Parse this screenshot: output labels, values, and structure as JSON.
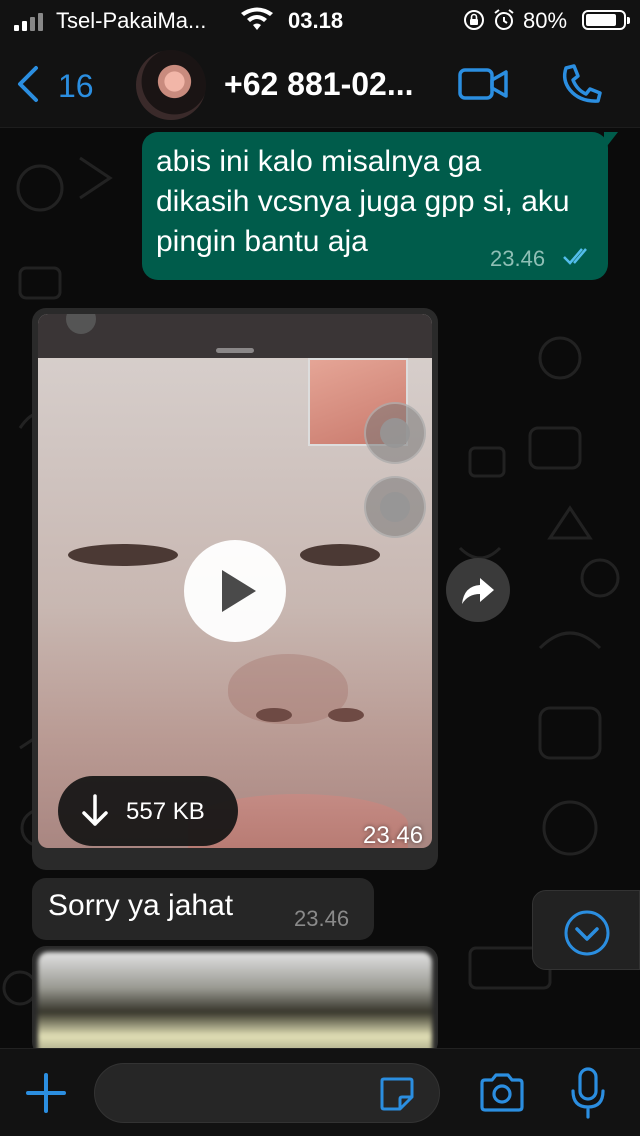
{
  "status_bar": {
    "carrier": "Tsel-PakaiMa...",
    "time": "03.18",
    "battery": "80%",
    "icons": [
      "signal-icon",
      "wifi-icon",
      "rotation-lock-icon",
      "alarm-icon",
      "battery-icon"
    ]
  },
  "header": {
    "back_count": "16",
    "contact_name": "+62 881-02...",
    "icons": [
      "chevron-left-icon",
      "video-call-icon",
      "phone-icon"
    ],
    "accent_color": "#2b8ee0"
  },
  "messages": [
    {
      "type": "outgoing_text",
      "text": "abis ini kalo misalnya ga dikasih vcsnya juga gpp si, aku pingin bantu aja",
      "time": "23.46",
      "status_icon": "double-check-icon",
      "bubble_color": "#005c4b"
    },
    {
      "type": "incoming_video",
      "size": "557 KB",
      "time": "23.46",
      "icons": [
        "play-icon",
        "download-icon",
        "forward-icon"
      ]
    },
    {
      "type": "incoming_text",
      "text": "Sorry ya jahat",
      "time": "23.46",
      "bubble_color": "#262626"
    },
    {
      "type": "incoming_image"
    }
  ],
  "input_bar": {
    "placeholder": "",
    "icons": [
      "plus-icon",
      "sticker-icon",
      "camera-icon",
      "microphone-icon"
    ]
  },
  "scroll_button_icon": "chevron-down-circle-icon"
}
